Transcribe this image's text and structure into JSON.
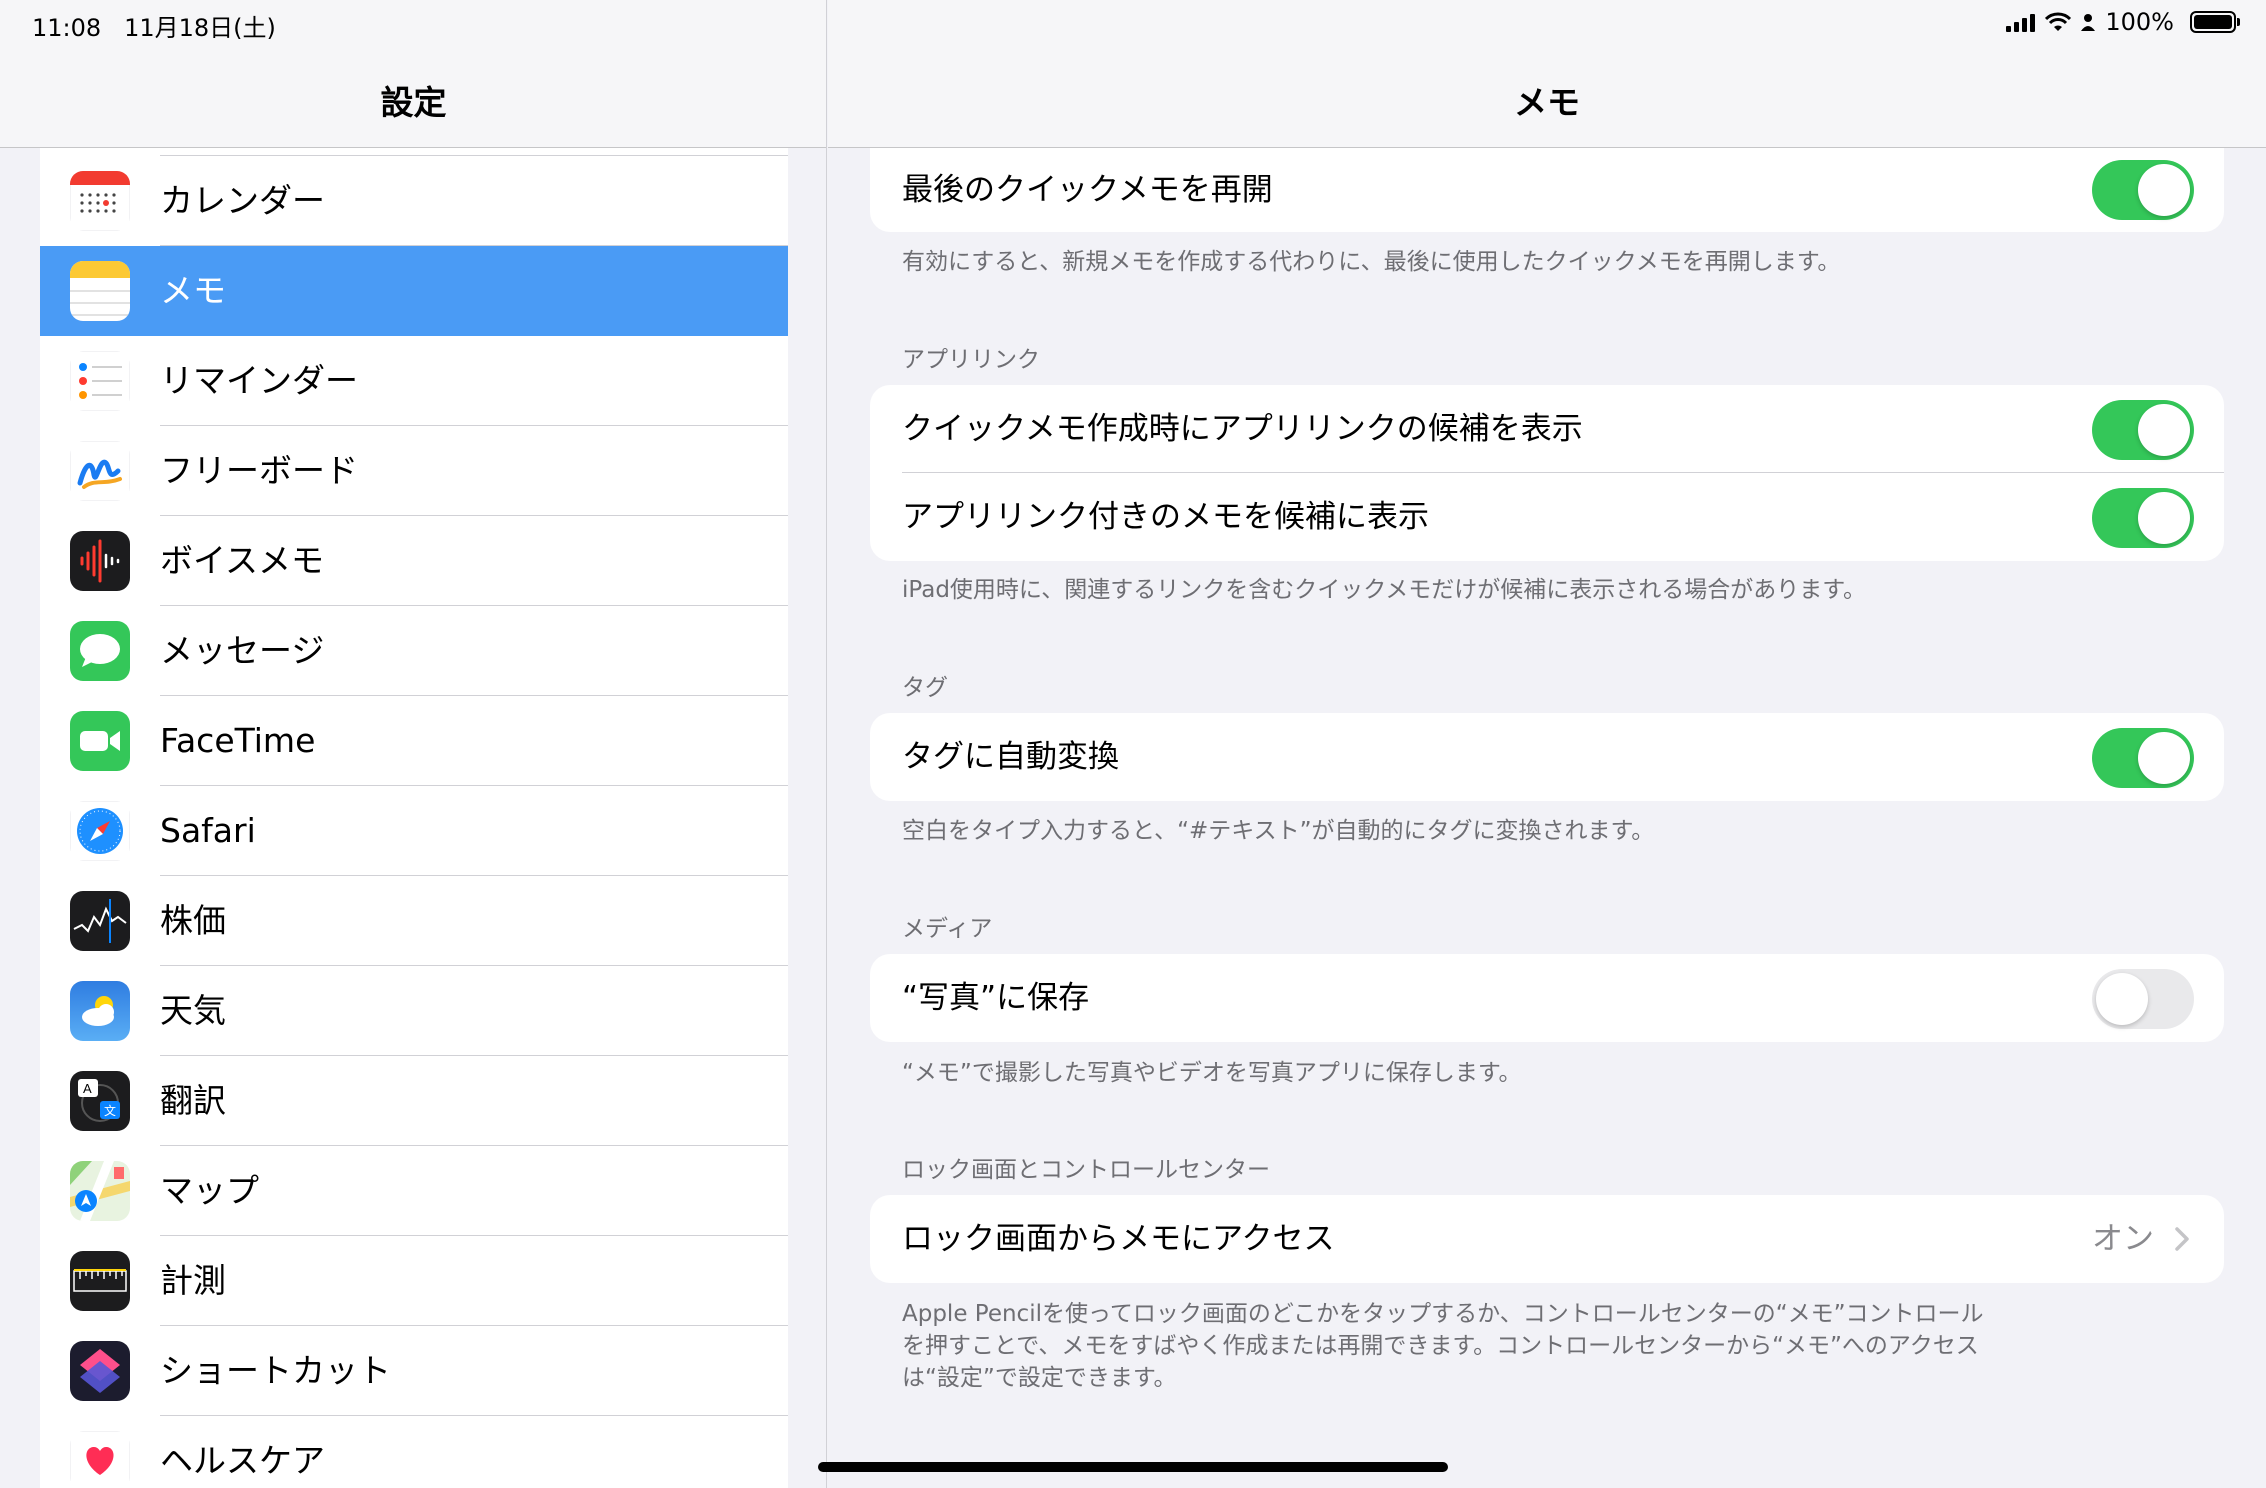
{
  "status_bar": {
    "time": "11:08",
    "date": "11月18日(土)",
    "battery": "100%"
  },
  "sidebar": {
    "title": "設定",
    "items": [
      {
        "label": "カレンダー",
        "icon": "calendar-icon"
      },
      {
        "label": "メモ",
        "icon": "notes-icon",
        "selected": true
      },
      {
        "label": "リマインダー",
        "icon": "reminders-icon"
      },
      {
        "label": "フリーボード",
        "icon": "freeform-icon"
      },
      {
        "label": "ボイスメモ",
        "icon": "voice-memos-icon"
      },
      {
        "label": "メッセージ",
        "icon": "messages-icon"
      },
      {
        "label": "FaceTime",
        "icon": "facetime-icon"
      },
      {
        "label": "Safari",
        "icon": "safari-icon"
      },
      {
        "label": "株価",
        "icon": "stocks-icon"
      },
      {
        "label": "天気",
        "icon": "weather-icon"
      },
      {
        "label": "翻訳",
        "icon": "translate-icon"
      },
      {
        "label": "マップ",
        "icon": "maps-icon"
      },
      {
        "label": "計測",
        "icon": "measure-icon"
      },
      {
        "label": "ショートカット",
        "icon": "shortcuts-icon"
      },
      {
        "label": "ヘルスケア",
        "icon": "health-icon"
      }
    ]
  },
  "detail": {
    "title": "メモ",
    "quick_note": {
      "resume_label": "最後のクイックメモを再開",
      "resume_on": true,
      "footer": "有効にすると、新規メモを作成する代わりに、最後に使用したクイックメモを再開します。"
    },
    "app_links": {
      "header": "アプリリンク",
      "suggest_label": "クイックメモ作成時にアプリリンクの候補を表示",
      "suggest_on": true,
      "show_label": "アプリリンク付きのメモを候補に表示",
      "show_on": true,
      "footer": "iPad使用時に、関連するリンクを含むクイックメモだけが候補に表示される場合があります。"
    },
    "tags": {
      "header": "タグ",
      "auto_convert_label": "タグに自動変換",
      "auto_convert_on": true,
      "footer": "空白をタイプ入力すると、“#テキスト”が自動的にタグに変換されます。"
    },
    "media": {
      "header": "メディア",
      "save_label": "“写真”に保存",
      "save_on": false,
      "footer": "“メモ”で撮影した写真やビデオを写真アプリに保存します。"
    },
    "lock_screen": {
      "header": "ロック画面とコントロールセンター",
      "access_label": "ロック画面からメモにアクセス",
      "access_value": "オン",
      "footer_line1": "Apple Pencilを使ってロック画面のどこかをタップするか、コントロールセンターの“メモ”コントロール",
      "footer_line2": "を押すことで、メモをすばやく作成または再開できます。コントロールセンターから“メモ”へのアクセス",
      "footer_line3": "は“設定”で設定できます。"
    }
  },
  "colors": {
    "accent_selected": "#4a9bf5",
    "toggle_on": "#34c759",
    "toggle_off": "#e9e9eb"
  }
}
